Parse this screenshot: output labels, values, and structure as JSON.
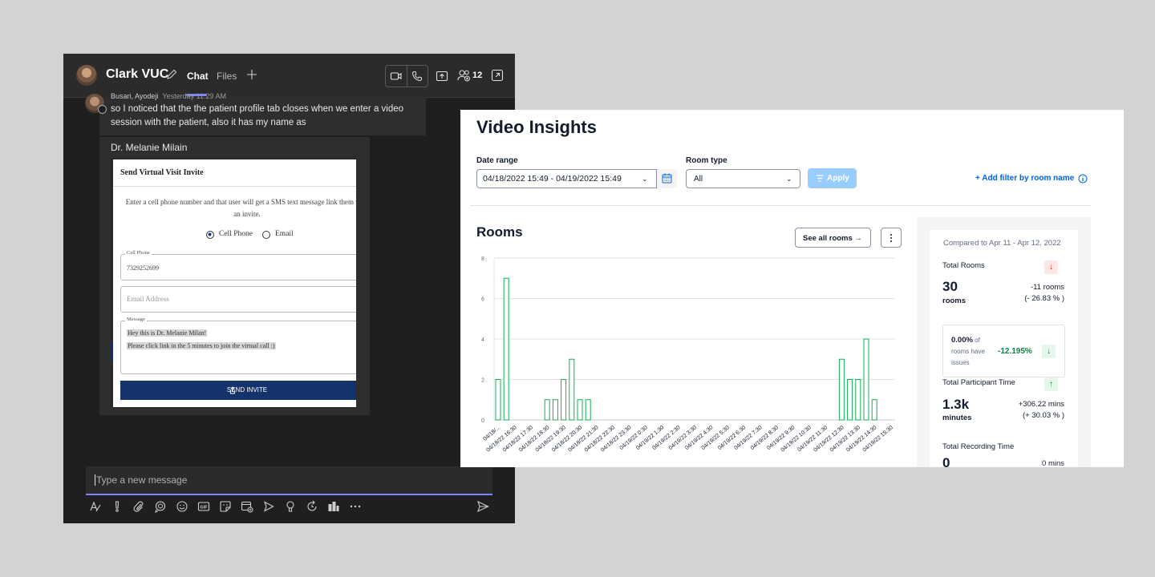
{
  "teams": {
    "chat_title": "Clark VUC",
    "tabs": [
      {
        "label": "Chat"
      },
      {
        "label": "Files"
      }
    ],
    "participants_count": "12",
    "messages": [
      {
        "sender": "Busari, Ayodeji",
        "time": "Yesterday 11:29 AM",
        "text": "so I noticed that the the patient profile tab closes when we enter a video session with the patient, also it has my name as"
      },
      {
        "sender": "Dr. Melanie Milain"
      }
    ],
    "compose_placeholder": "Type a new message",
    "toolbar_icons": [
      "format-icon",
      "important-icon",
      "attach-icon",
      "loop-icon",
      "emoji-icon",
      "gif-icon",
      "sticker-icon",
      "schedule-meeting-icon",
      "stream-icon",
      "praise-icon",
      "loop-refresh-icon",
      "approvals-icon",
      "more-options-icon"
    ]
  },
  "invite": {
    "title": "Send Virtual Visit Invite",
    "description": "Enter a cell phone number and that user will get a SMS text message link them with an invite.",
    "options": [
      {
        "label": "Cell Phone",
        "selected": true
      },
      {
        "label": "Email",
        "selected": false
      }
    ],
    "cell_phone_legend": "Cell Phone",
    "cell_phone_value": "7329252699",
    "email_placeholder": "Email Address",
    "message_legend": "Message",
    "message_lines": [
      "Hey this is Dr. Melanie Milan!",
      "Please click link in the 5 minutes to join the virtual call :)"
    ],
    "send_label": "SEND INVITE"
  },
  "insights": {
    "title": "Video Insights",
    "date_range_label": "Date range",
    "date_range_value": "04/18/2022 15:49 - 04/19/2022 15:49",
    "room_type_label": "Room type",
    "room_type_value": "All",
    "apply_label": "Apply",
    "add_filter_label": "+ Add filter by room name",
    "rooms_title": "Rooms",
    "see_all_label": "See all rooms →",
    "stats": {
      "compared_to": "Compared to Apr 11 - Apr 12, 2022",
      "total_rooms_label": "Total Rooms",
      "total_rooms_value": "30",
      "total_rooms_unit": "rooms",
      "total_rooms_delta": "-11 rooms",
      "total_rooms_delta_pct": "(- 26.83 % )",
      "issues_pct": "0.00%",
      "issues_text": "of rooms have issues",
      "issues_delta": "-12.195%",
      "participant_time_label": "Total Participant Time",
      "participant_time_value": "1.3k",
      "participant_time_unit": "minutes",
      "participant_time_delta": "+306.22 mins",
      "participant_time_delta_pct": "(+ 30.03 % )",
      "recording_time_label": "Total Recording Time",
      "recording_time_value": "0",
      "recording_time_delta": "0 mins"
    },
    "colors": {
      "accent": "#0263e0",
      "bar_stroke": "#14b053",
      "down": "#d61f1f",
      "up": "#14804a"
    }
  },
  "chart_data": {
    "type": "bar",
    "title": "Rooms",
    "ylim": [
      0,
      8
    ],
    "yticks": [
      0,
      2,
      4,
      6,
      8
    ],
    "grid": true,
    "values": [
      2,
      7,
      0,
      0,
      0,
      0,
      1,
      1,
      2,
      3,
      1,
      1,
      0,
      0,
      0,
      0,
      0,
      0,
      0,
      0,
      0,
      0,
      0,
      0,
      0,
      0,
      0,
      0,
      0,
      0,
      0,
      0,
      0,
      0,
      0,
      0,
      0,
      0,
      0,
      0,
      0,
      0,
      3,
      2,
      2,
      4,
      1,
      0,
      0
    ],
    "tick_labels": [
      "04/18/...",
      "04/18/22 16:30",
      "04/18/22 17:30",
      "04/18/22 18:30",
      "04/18/22 19:30",
      "04/18/22 20:30",
      "04/18/22 21:30",
      "04/18/22 22:30",
      "04/18/22 23:30",
      "04/19/22 0:30",
      "04/19/22 1:30",
      "04/19/22 2:30",
      "04/19/22 3:30",
      "04/19/22 4:30",
      "04/19/22 5:30",
      "04/19/22 6:30",
      "04/19/22 7:30",
      "04/19/22 8:30",
      "04/19/22 9:30",
      "04/19/22 10:30",
      "04/19/22 11:30",
      "04/19/22 12:30",
      "04/19/22 13:30",
      "04/19/22 14:30",
      "04/19/22 15:30"
    ]
  }
}
